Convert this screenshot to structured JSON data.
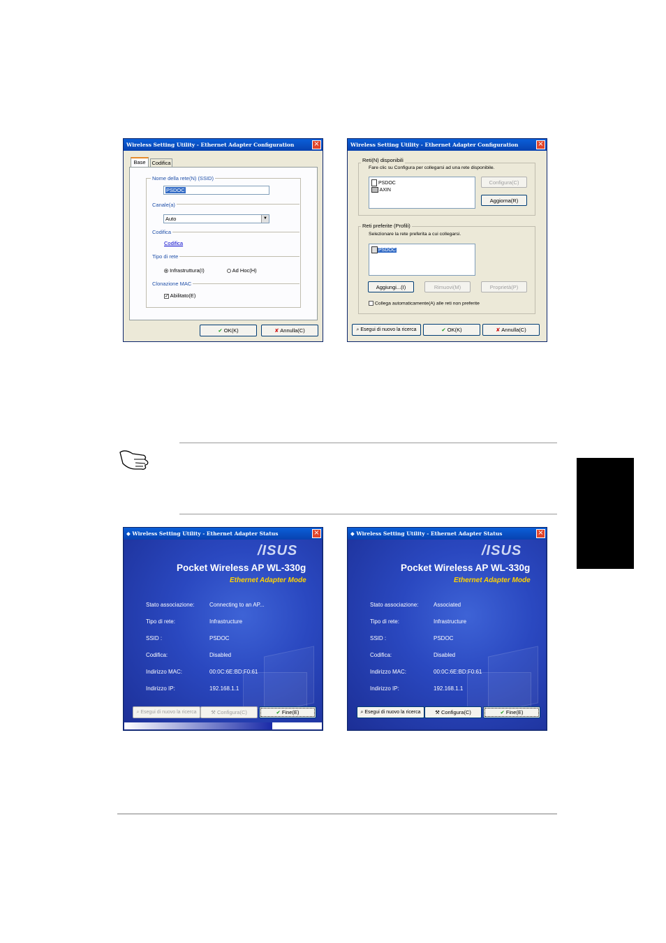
{
  "dialog1": {
    "title": "Wireless Setting Utility - Ethernet Adapter Configuration",
    "tabs": [
      "Base",
      "Codifica"
    ],
    "ssid_group": "Nome della rete(N) (SSID)",
    "ssid_value": "PSDOC",
    "channel_group": "Canale(a)",
    "channel_value": "Auto",
    "encryption_group": "Codifica",
    "encryption_link": "Codifica",
    "network_type_group": "Tipo di rete",
    "radio_infra": "Infrastruttura(I)",
    "radio_adhoc": "Ad Hoc(H)",
    "mac_group": "Clonazione MAC",
    "mac_checkbox": "Abilitato(E)",
    "ok": "OK(K)",
    "cancel": "Annulla(C)"
  },
  "dialog2": {
    "title": "Wireless Setting Utility - Ethernet Adapter Configuration",
    "available_group": "Reti(N) disponibili",
    "available_hint": "Fare clic su Configura per collegarsi ad una rete disponibile.",
    "available_networks": [
      "PSDOC",
      "AXIN"
    ],
    "configure": "Configura(C)",
    "refresh": "Aggiorna(R)",
    "preferred_group": "Reti preferite (Profili)",
    "preferred_hint": "Selezionare la rete preferita a cui collegarsi.",
    "preferred_networks": [
      "PSDOC"
    ],
    "add": "Aggiungi...(I)",
    "remove": "Rimuovi(M)",
    "properties": "Proprietà(P)",
    "auto_connect": "Collega automaticamente(A) alle reti non preferite",
    "rescan": "Esegui di nuovo la ricerca",
    "ok": "OK(K)",
    "cancel": "Annulla(C)"
  },
  "status1": {
    "title": "Wireless Setting Utility - Ethernet Adapter Status",
    "logo": "/ISUS",
    "product": "Pocket Wireless AP WL-330g",
    "mode": "Ethernet Adapter Mode",
    "rows": [
      {
        "label": "Stato associazione:",
        "value": "Connecting to an AP..."
      },
      {
        "label": "Tipo di rete:",
        "value": "Infrastructure"
      },
      {
        "label": "SSID :",
        "value": "PSDOC"
      },
      {
        "label": "Codifica:",
        "value": "Disabled"
      },
      {
        "label": "Indirizzo MAC:",
        "value": "00:0C:6E:BD:F0:61"
      },
      {
        "label": "Indirizzo IP:",
        "value": "192.168.1.1"
      }
    ],
    "rescan": "Esegui di nuovo la ricerca",
    "configure": "Configura(C)",
    "finish": "Fine(E)",
    "progress": 0.75
  },
  "status2": {
    "title": "Wireless Setting Utility - Ethernet Adapter Status",
    "logo": "/ISUS",
    "product": "Pocket Wireless AP WL-330g",
    "mode": "Ethernet Adapter Mode",
    "rows": [
      {
        "label": "Stato associazione:",
        "value": "Associated"
      },
      {
        "label": "Tipo di rete:",
        "value": "Infrastructure"
      },
      {
        "label": "SSID :",
        "value": "PSDOC"
      },
      {
        "label": "Codifica:",
        "value": "Disabled"
      },
      {
        "label": "Indirizzo MAC:",
        "value": "00:0C:6E:BD:F0:61"
      },
      {
        "label": "Indirizzo IP:",
        "value": "192.168.1.1"
      }
    ],
    "rescan": "Esegui di nuovo la ricerca",
    "configure": "Configura(C)",
    "finish": "Fine(E)"
  }
}
